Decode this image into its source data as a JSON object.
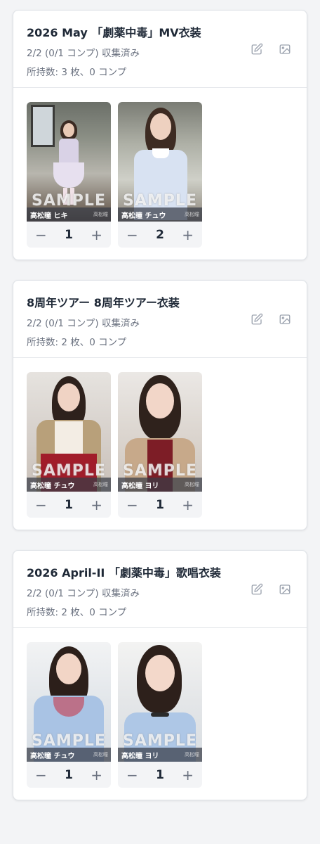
{
  "cards": [
    {
      "title": "2026 May 「劇薬中毒」MV衣装",
      "progress": "2/2 (0/1 コンプ) 収集済み",
      "owned": "所持数: 3 枚、0 コンプ",
      "items": [
        {
          "name": "高松瞳 ヒキ",
          "signature": "高松瞳",
          "watermark": "SAMPLE",
          "quantity": "1"
        },
        {
          "name": "高松瞳 チュウ",
          "signature": "高松瞳",
          "watermark": "SAMPLE",
          "quantity": "2"
        }
      ]
    },
    {
      "title": "8周年ツアー 8周年ツアー衣装",
      "progress": "2/2 (0/1 コンプ) 収集済み",
      "owned": "所持数: 2 枚、0 コンプ",
      "items": [
        {
          "name": "高松瞳 チュウ",
          "signature": "高松瞳",
          "watermark": "SAMPLE",
          "quantity": "1"
        },
        {
          "name": "高松瞳 ヨリ",
          "signature": "高松瞳",
          "watermark": "SAMPLE",
          "quantity": "1"
        }
      ]
    },
    {
      "title": "2026 April-II 「劇薬中毒」歌唱衣装",
      "progress": "2/2 (0/1 コンプ) 収集済み",
      "owned": "所持数: 2 枚、0 コンプ",
      "items": [
        {
          "name": "高松瞳 チュウ",
          "signature": "高松瞳",
          "watermark": "SAMPLE",
          "quantity": "1"
        },
        {
          "name": "高松瞳 ヨリ",
          "signature": "高松瞳",
          "watermark": "SAMPLE",
          "quantity": "1"
        }
      ]
    }
  ],
  "controls": {
    "decrement": "−",
    "increment": "+"
  },
  "icons": {
    "edit": "pencil-edit-icon",
    "image": "image-icon"
  },
  "colors": {
    "page_bg": "#f3f4f6",
    "card_bg": "#ffffff",
    "title": "#1f2937",
    "meta": "#6b7280"
  }
}
